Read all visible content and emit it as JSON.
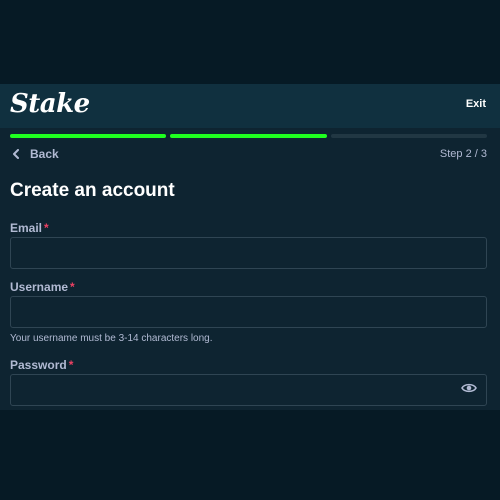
{
  "header": {
    "logo": "Stake",
    "exit_label": "Exit"
  },
  "progress": {
    "current_step": 2,
    "total_steps": 3
  },
  "nav": {
    "back_label": "Back",
    "step_text": "Step 2 / 3"
  },
  "form": {
    "title": "Create an account",
    "email": {
      "label": "Email",
      "required_mark": "*",
      "value": ""
    },
    "username": {
      "label": "Username",
      "required_mark": "*",
      "value": "",
      "hint": "Your username must be 3-14 characters long."
    },
    "password": {
      "label": "Password",
      "required_mark": "*",
      "value": "",
      "toggle_icon": "eye-icon"
    }
  },
  "colors": {
    "background": "#061a25",
    "panel": "#0e2431",
    "header": "#10303f",
    "accent_green": "#1fff20",
    "required_red": "#ed4163",
    "muted_text": "#b1bad3",
    "input_border": "#2f4553"
  }
}
